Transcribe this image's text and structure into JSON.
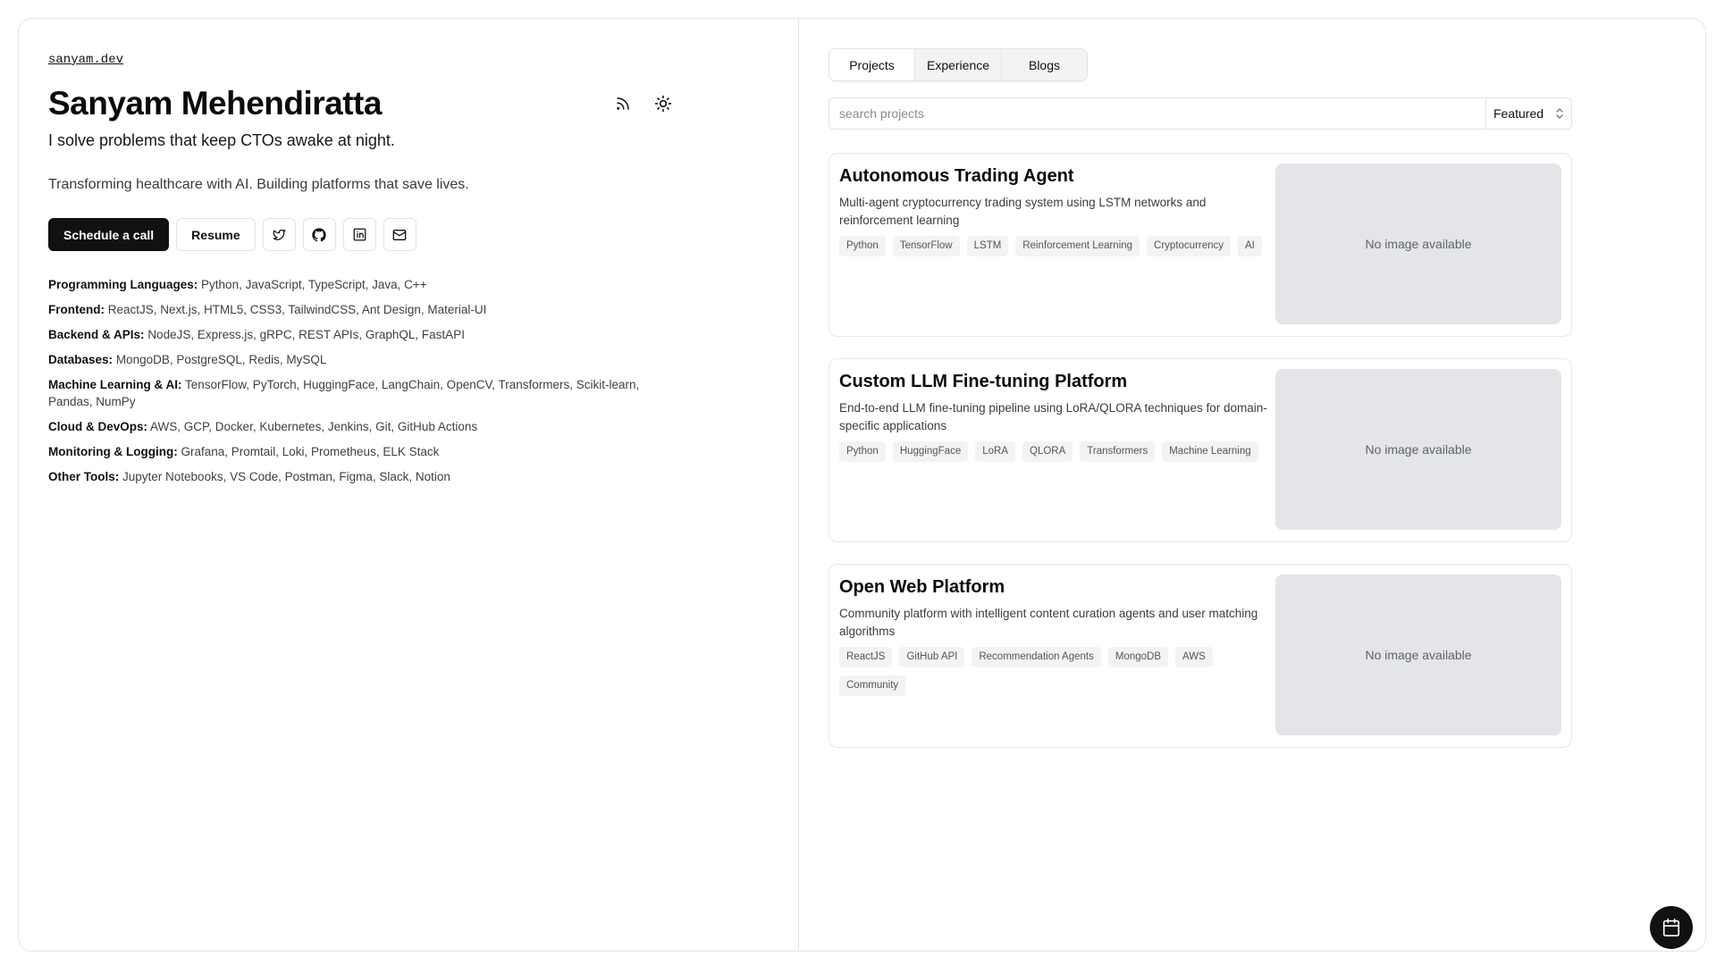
{
  "site": {
    "link": "sanyam.dev"
  },
  "profile": {
    "name": "Sanyam Mehendiratta",
    "tagline": "I solve problems that keep CTOs awake at night.",
    "subline": "Transforming healthcare with AI. Building platforms that save lives."
  },
  "header_icons": [
    "rss-icon",
    "sun-icon"
  ],
  "actions": {
    "schedule_label": "Schedule a call",
    "resume_label": "Resume",
    "social_icons": [
      "twitter-icon",
      "github-icon",
      "linkedin-icon",
      "mail-icon"
    ]
  },
  "skills": [
    {
      "label": "Programming Languages:",
      "value": "Python, JavaScript, TypeScript, Java, C++"
    },
    {
      "label": "Frontend:",
      "value": "ReactJS, Next.js, HTML5, CSS3, TailwindCSS, Ant Design, Material-UI"
    },
    {
      "label": "Backend & APIs:",
      "value": "NodeJS, Express.js, gRPC, REST APIs, GraphQL, FastAPI"
    },
    {
      "label": "Databases:",
      "value": "MongoDB, PostgreSQL, Redis, MySQL"
    },
    {
      "label": "Machine Learning & AI:",
      "value": "TensorFlow, PyTorch, HuggingFace, LangChain, OpenCV, Transformers, Scikit-learn, Pandas, NumPy"
    },
    {
      "label": "Cloud & DevOps:",
      "value": "AWS, GCP, Docker, Kubernetes, Jenkins, Git, GitHub Actions"
    },
    {
      "label": "Monitoring & Logging:",
      "value": "Grafana, Promtail, Loki, Prometheus, ELK Stack"
    },
    {
      "label": "Other Tools:",
      "value": "Jupyter Notebooks, VS Code, Postman, Figma, Slack, Notion"
    }
  ],
  "tabs": [
    {
      "label": "Projects",
      "active": true
    },
    {
      "label": "Experience",
      "active": false
    },
    {
      "label": "Blogs",
      "active": false
    }
  ],
  "search": {
    "placeholder": "search projects",
    "value": ""
  },
  "sort": {
    "selected": "Featured"
  },
  "projects": [
    {
      "title": "Autonomous Trading Agent",
      "description": "Multi-agent cryptocurrency trading system using LSTM networks and reinforcement learning",
      "tags": [
        "Python",
        "TensorFlow",
        "LSTM",
        "Reinforcement Learning",
        "Cryptocurrency",
        "AI"
      ],
      "image_text": "No image available"
    },
    {
      "title": "Custom LLM Fine-tuning Platform",
      "description": "End-to-end LLM fine-tuning pipeline using LoRA/QLORA techniques for domain-specific applications",
      "tags": [
        "Python",
        "HuggingFace",
        "LoRA",
        "QLORA",
        "Transformers",
        "Machine Learning"
      ],
      "image_text": "No image available"
    },
    {
      "title": "Open Web Platform",
      "description": "Community platform with intelligent content curation agents and user matching algorithms",
      "tags": [
        "ReactJS",
        "GitHub API",
        "Recommendation Agents",
        "MongoDB",
        "AWS",
        "Community"
      ],
      "image_text": "No image available"
    }
  ],
  "fab_icon": "calendar-icon"
}
